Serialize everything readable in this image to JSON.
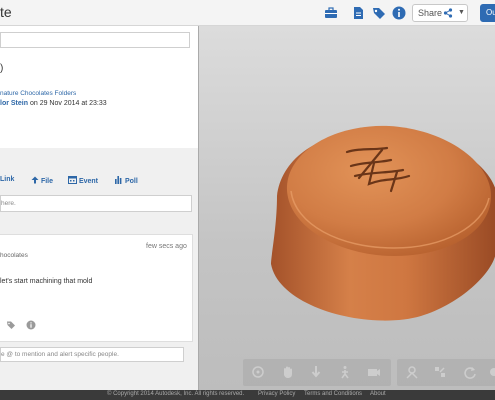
{
  "topbar": {
    "title": "te",
    "share_label": "Share",
    "blue_button_label": "Ou",
    "icons": [
      "toolbox-icon",
      "document-icon",
      "tag-icon",
      "info-icon"
    ]
  },
  "left": {
    "paren_text": ")",
    "folder_link": "nature Chocolates Folders",
    "author": "lor Stein",
    "date_text": " on 29 Nov 2014 at 23:33",
    "actions": {
      "link": "Link",
      "file": "File",
      "event": "Event",
      "poll": "Poll"
    },
    "post_placeholder": "here.",
    "card": {
      "folder": "hocolates",
      "time": "few secs ago",
      "message": "let's start machining that mold"
    },
    "comment_placeholder": "e @ to mention and alert specific people."
  },
  "viewer": {
    "model_color": "#c4703d"
  },
  "footer": {
    "copyright": "© Copyright 2014 Autodesk, Inc. All rights reserved.",
    "privacy": "Privacy Policy",
    "terms": "Terms and Conditions",
    "about": "About"
  }
}
